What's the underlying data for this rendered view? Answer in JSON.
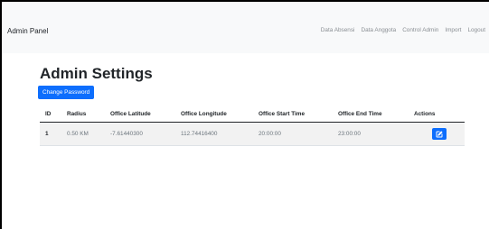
{
  "navbar": {
    "brand": "Admin Panel",
    "links": [
      "Data Absensi",
      "Data Anggota",
      "Control Admin",
      "Import",
      "Logout"
    ]
  },
  "page": {
    "title": "Admin Settings",
    "change_password_label": "Change Password"
  },
  "table": {
    "headers": [
      "ID",
      "Radius",
      "Office Latitude",
      "Office Longitude",
      "Office Start Time",
      "Office End Time",
      "Actions"
    ],
    "rows": [
      {
        "id": "1",
        "radius": "0.50 KM",
        "latitude": "-7.61440300",
        "longitude": "112.74416400",
        "start_time": "20:00:00",
        "end_time": "23:00:00",
        "action_icon": "edit-icon"
      }
    ]
  },
  "colors": {
    "primary": "#0d6efd",
    "navbar_bg": "#f8f9fa",
    "row_bg": "#f2f2f2"
  }
}
